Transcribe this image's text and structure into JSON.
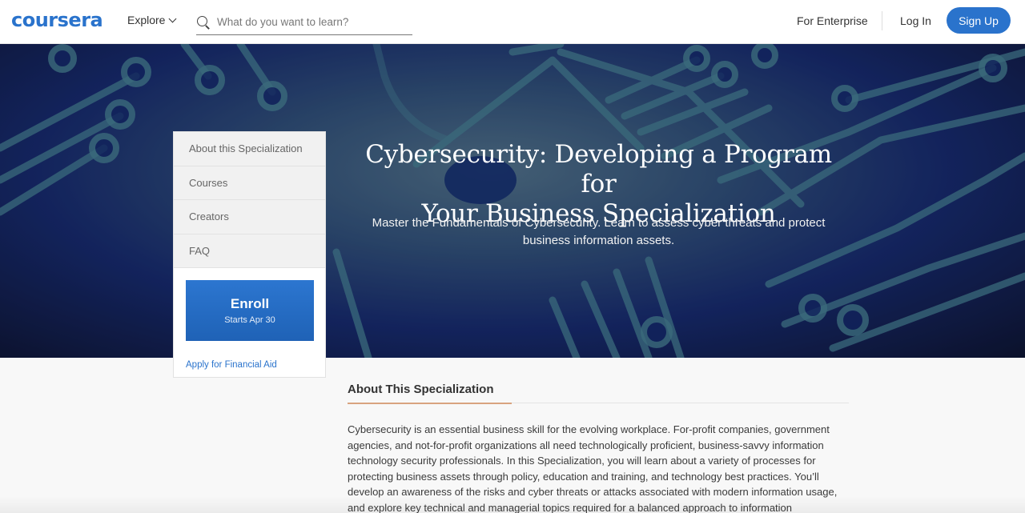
{
  "header": {
    "logo": "coursera",
    "explore_label": "Explore",
    "search_placeholder": "What do you want to learn?",
    "search_value": "",
    "enterprise_label": "For Enterprise",
    "login_label": "Log In",
    "signup_label": "Sign Up"
  },
  "hero": {
    "title_line1": "Cybersecurity: Developing a Program for",
    "title_line2": "Your Business Specialization",
    "subtitle": "Master the Fundamentals of Cybersecurity. Learn to assess cyber threats and protect business information assets."
  },
  "sidenav": {
    "items": [
      {
        "label": "About this Specialization"
      },
      {
        "label": "Courses"
      },
      {
        "label": "Creators"
      },
      {
        "label": "FAQ"
      }
    ],
    "enroll_label": "Enroll",
    "enroll_sub": "Starts Apr 30",
    "financial_aid": "Apply for Financial Aid"
  },
  "about": {
    "heading": "About This Specialization",
    "body": "Cybersecurity is an essential business skill for the evolving workplace. For-profit companies, government agencies, and not-for-profit organizations all need technologically proficient, business-savvy information technology security professionals. In this Specialization, you will learn about a variety of processes for protecting business assets through policy, education and training, and technology best practices. You’ll develop an awareness of the risks and cyber threats or attacks associated with modern information usage, and explore key technical and managerial topics required for a balanced approach to information"
  },
  "colors": {
    "brand": "#2a73cc",
    "accent_rule": "#d9a37f"
  }
}
